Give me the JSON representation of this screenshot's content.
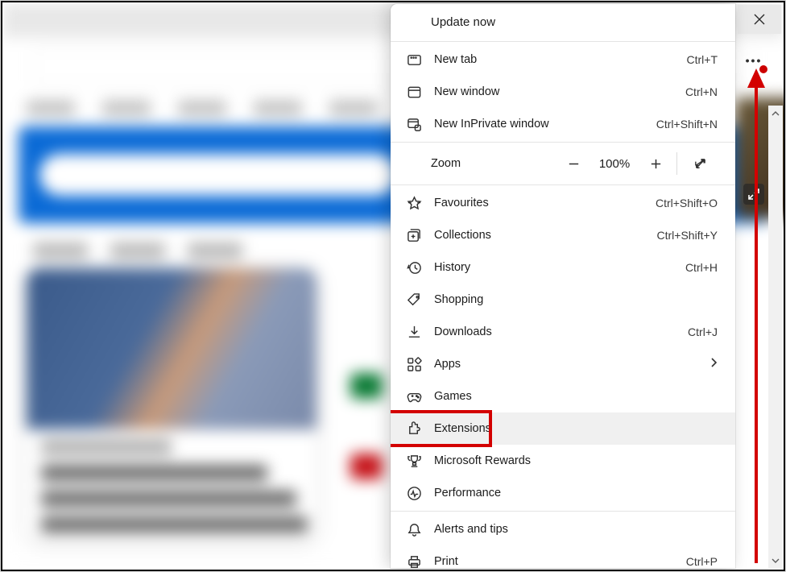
{
  "menu": {
    "header": "Update now",
    "items": [
      {
        "icon": "new-tab-icon",
        "label": "New tab",
        "shortcut": "Ctrl+T"
      },
      {
        "icon": "new-window-icon",
        "label": "New window",
        "shortcut": "Ctrl+N"
      },
      {
        "icon": "inprivate-icon",
        "label": "New InPrivate window",
        "shortcut": "Ctrl+Shift+N"
      }
    ],
    "zoom": {
      "label": "Zoom",
      "value": "100%"
    },
    "items2": [
      {
        "icon": "star-icon",
        "label": "Favourites",
        "shortcut": "Ctrl+Shift+O"
      },
      {
        "icon": "collections-icon",
        "label": "Collections",
        "shortcut": "Ctrl+Shift+Y"
      },
      {
        "icon": "history-icon",
        "label": "History",
        "shortcut": "Ctrl+H"
      },
      {
        "icon": "tag-icon",
        "label": "Shopping",
        "shortcut": ""
      },
      {
        "icon": "download-icon",
        "label": "Downloads",
        "shortcut": "Ctrl+J"
      },
      {
        "icon": "apps-icon",
        "label": "Apps",
        "shortcut": "",
        "chevron": true
      },
      {
        "icon": "games-icon",
        "label": "Games",
        "shortcut": ""
      },
      {
        "icon": "puzzle-icon",
        "label": "Extensions",
        "shortcut": "",
        "highlight": true,
        "hovered": true
      },
      {
        "icon": "trophy-icon",
        "label": "Microsoft Rewards",
        "shortcut": ""
      },
      {
        "icon": "pulse-icon",
        "label": "Performance",
        "shortcut": ""
      }
    ],
    "items3": [
      {
        "icon": "bell-icon",
        "label": "Alerts and tips",
        "shortcut": ""
      },
      {
        "icon": "print-icon",
        "label": "Print",
        "shortcut": "Ctrl+P"
      }
    ]
  }
}
